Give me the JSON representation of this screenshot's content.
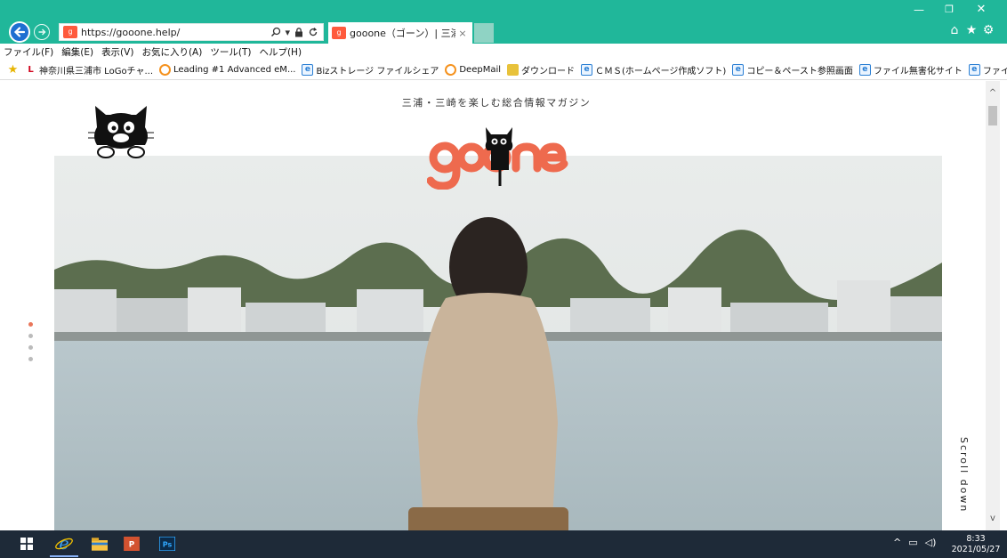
{
  "browser": {
    "url": "https://gooone.help/",
    "tab_title": "gooone（ゴーン）| 三浦･三...",
    "tab_close": "×",
    "menu": [
      "ファイル(F)",
      "編集(E)",
      "表示(V)",
      "お気に入り(A)",
      "ツール(T)",
      "ヘルプ(H)"
    ],
    "favorites": [
      {
        "icon": "star-add-icon",
        "label": ""
      },
      {
        "icon": "l-icon",
        "label": "神奈川県三浦市 LoGoチャ..."
      },
      {
        "icon": "orange-ring-icon",
        "label": "Leading #1 Advanced eM..."
      },
      {
        "icon": "ie-page-icon",
        "label": "Bizストレージ ファイルシェア"
      },
      {
        "icon": "orange-ring-icon",
        "label": "DeepMail"
      },
      {
        "icon": "download-icon",
        "label": "ダウンロード"
      },
      {
        "icon": "ie-page-icon",
        "label": "ＣＭＳ(ホームページ作成ソフト)"
      },
      {
        "icon": "ie-page-icon",
        "label": "コピー＆ペースト参照画面"
      },
      {
        "icon": "ie-page-icon",
        "label": "ファイル無害化サイト"
      },
      {
        "icon": "ie-page-icon",
        "label": "ファイル交換"
      }
    ],
    "window_controls": {
      "minimize": "—",
      "maximize": "❐",
      "close": "✕"
    },
    "toolbar_icons": {
      "home": "⌂",
      "favorites": "★",
      "settings": "⚙"
    }
  },
  "page": {
    "tagline": "三浦・三崎を楽しむ総合情報マガジン",
    "logo_text": "gooone",
    "scroll_label": "Scroll down",
    "slide_count": 4,
    "active_slide": 1,
    "accent_color": "#ee6a4e"
  },
  "taskbar": {
    "apps": [
      "start-icon",
      "internet-explorer-icon",
      "file-explorer-icon",
      "powerpoint-icon",
      "photoshop-icon"
    ],
    "clock_time": "8:33",
    "clock_date": "2021/05/27"
  }
}
